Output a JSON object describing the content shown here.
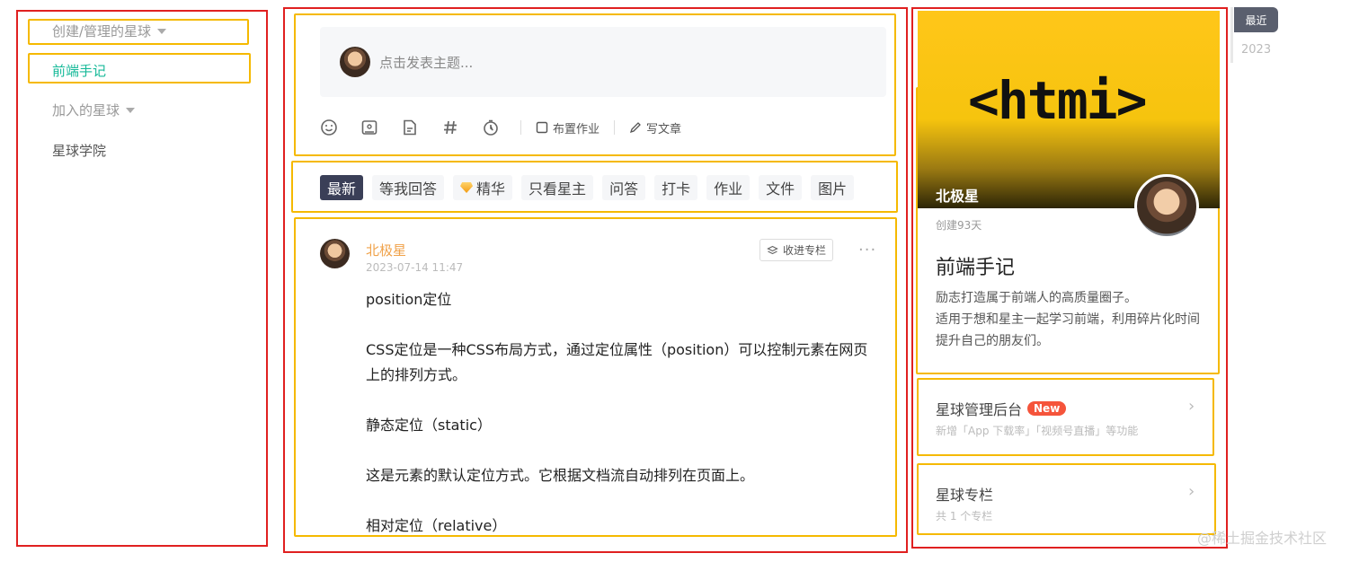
{
  "sidebar": {
    "items": [
      {
        "label": "创建/管理的星球"
      },
      {
        "label": "前端手记"
      },
      {
        "label": "加入的星球"
      },
      {
        "label": "星球学院"
      }
    ]
  },
  "composer": {
    "placeholder": "点击发表主题..."
  },
  "toolbar": {
    "assign_homework": "布置作业",
    "write_article": "写文章"
  },
  "tabs": [
    "最新",
    "等我回答",
    "精华",
    "只看星主",
    "问答",
    "打卡",
    "作业",
    "文件",
    "图片"
  ],
  "post": {
    "author": "北极星",
    "time": "2023-07-14 11:47",
    "collect_label": "收进专栏",
    "more": "···",
    "paragraphs": [
      "position定位",
      "CSS定位是一种CSS布局方式，通过定位属性（position）可以控制元素在网页上的排列方式。",
      "静态定位（static）",
      "这是元素的默认定位方式。它根据文档流自动排列在页面上。",
      "相对定位（relative）"
    ]
  },
  "club": {
    "cover_text": "<htmi>",
    "owner": "北极星",
    "created": "创建93天",
    "title": "前端手记",
    "desc_1": "励志打造属于前端人的高质量圈子。",
    "desc_2": "适用于想和星主一起学习前端，利用碎片化时间提升自己的朋友们。"
  },
  "admin_card": {
    "title": "星球管理后台",
    "badge": "New",
    "sub": "新增「App 下载率」「视频号直播」等功能"
  },
  "column_card": {
    "title": "星球专栏",
    "sub": "共 1 个专栏"
  },
  "timeline": {
    "recent": "最近",
    "year": "2023"
  },
  "watermark": "@稀土掘金技术社区",
  "colors": {
    "accent_green": "#16b998",
    "author_orange": "#f0a24a",
    "active_tab": "#3a3f57",
    "badge_red": "#f5543b",
    "annotation_red": "#e02020",
    "annotation_yellow": "#f5b900"
  }
}
